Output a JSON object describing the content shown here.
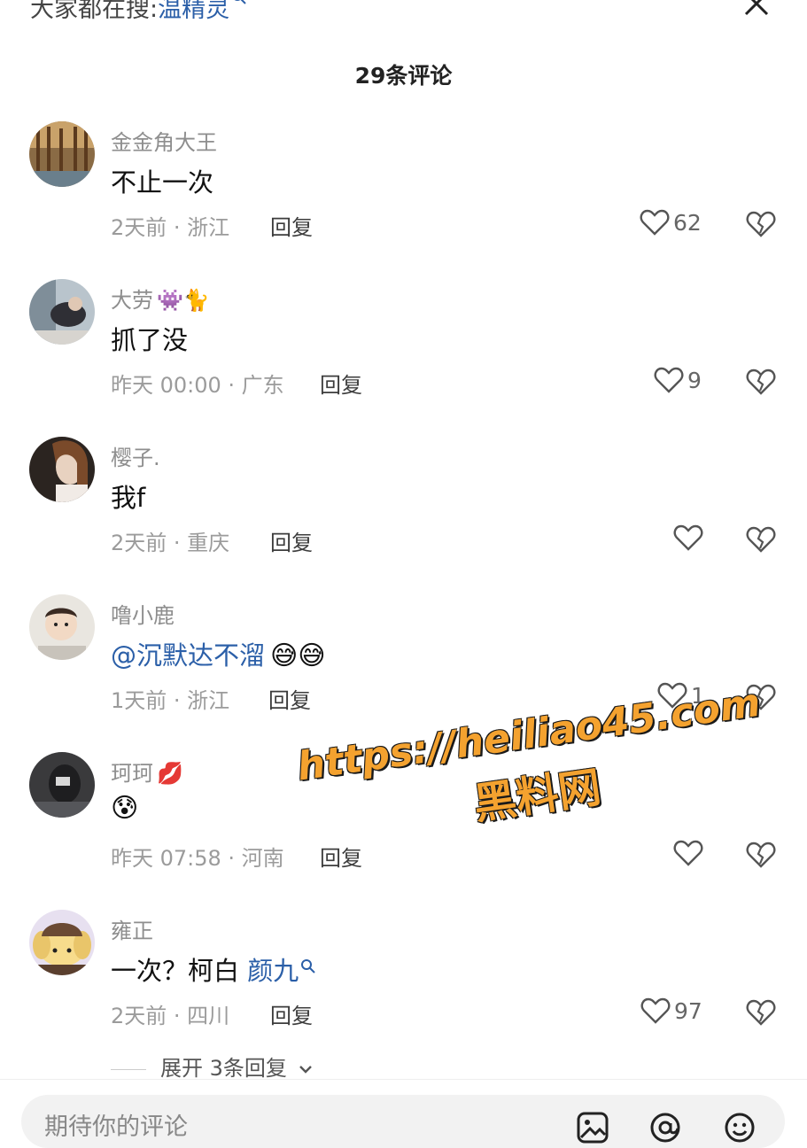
{
  "header": {
    "search_prefix": "大家都在搜:",
    "search_keyword": "温精灵",
    "comment_count_label": "29条评论"
  },
  "comments": [
    {
      "username": "金金角大王",
      "name_emojis": "",
      "text": "不止一次",
      "meta": "2天前 · 浙江",
      "reply": "回复",
      "likes": "62"
    },
    {
      "username": "大劳",
      "name_emojis": "👾🐈",
      "text": "抓了没",
      "meta": "昨天 00:00 · 广东",
      "reply": "回复",
      "likes": "9"
    },
    {
      "username": "樱子.",
      "name_emojis": "",
      "text": "我f",
      "meta": "2天前 · 重庆",
      "reply": "回复",
      "likes": ""
    },
    {
      "username": "噜小鹿",
      "name_emojis": "",
      "text_mention": "@沉默达不溜",
      "text_emojis": "😅😅",
      "meta": "1天前 · 浙江",
      "reply": "回复",
      "likes": "1"
    },
    {
      "username": "珂珂",
      "name_emojis": "💋",
      "text_emojis": "😰",
      "meta": "昨天 07:58 · 河南",
      "reply": "回复",
      "likes": ""
    },
    {
      "username": "雍正",
      "name_emojis": "",
      "text": "一次？柯白 ",
      "text_link": "颜九",
      "meta": "2天前 · 四川",
      "reply": "回复",
      "likes": "97"
    }
  ],
  "expand_replies": "展开 3条回复",
  "watermark": {
    "url": "https://heiliao45.com",
    "name": "黑料网"
  },
  "input": {
    "placeholder": "期待你的评论"
  },
  "colors": {
    "link": "#2b5fa8",
    "watermark": "#f4a22f"
  },
  "icons": [
    "search-icon",
    "close-icon",
    "heart-icon",
    "broken-heart-icon",
    "image-icon",
    "at-icon",
    "emoji-icon",
    "chevron-down-icon"
  ]
}
